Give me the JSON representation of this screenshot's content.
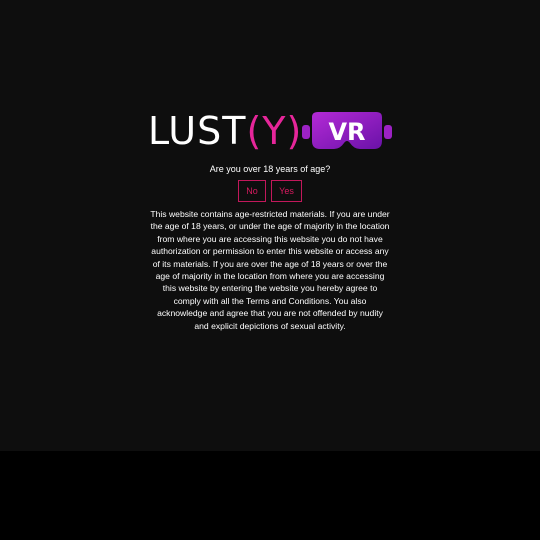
{
  "logo": {
    "brand": "LUST",
    "paren_open": "(",
    "letter": "Y",
    "paren_close": ")",
    "headset_text": "VR",
    "headset_icon": "vr-headset-icon",
    "accent_color": "#e6269a",
    "headset_color": "#8e1ec8"
  },
  "gate": {
    "question": "Are you over 18 years of age?",
    "no_label": "No",
    "yes_label": "Yes",
    "disclaimer": "This website contains age-restricted materials. If you are under the age of 18 years, or under the age of majority in the location from where you are accessing this website you do not have authorization or permission to enter this website or access any of its materials. If you are over the age of 18 years or over the age of majority in the location from where you are accessing this website by entering the website you hereby agree to comply with all the Terms and Conditions. You also acknowledge and agree that you are not offended by nudity and explicit depictions of sexual activity."
  },
  "colors": {
    "background": "#0e0e0e",
    "button_border": "#c2185b",
    "button_text": "#d81b60"
  }
}
